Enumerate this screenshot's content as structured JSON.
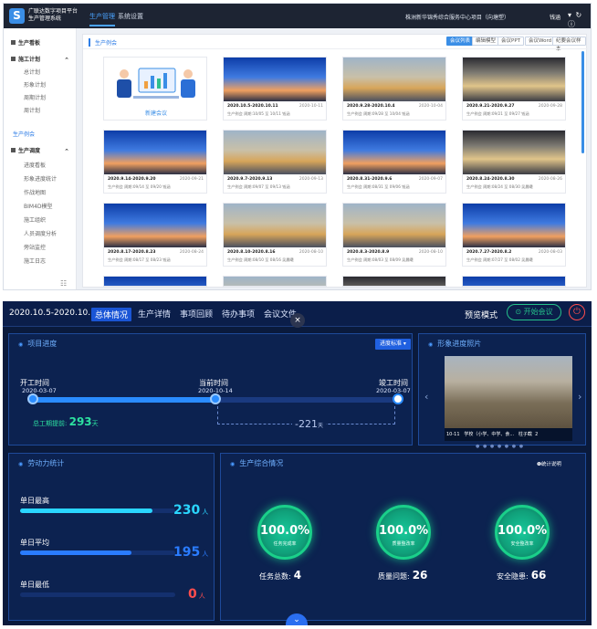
{
  "top": {
    "app_title": "广联达数字项目平台 生产管理系统",
    "logo_letter": "S",
    "nav": [
      "生产管理",
      "系统设置"
    ],
    "org": "株洲新华锦秀综合服务中心项目（向塘塑）",
    "user": "钱涵",
    "top_icons": "▾ ↻ ⓘ",
    "sidebar": {
      "items": [
        {
          "label": "生产看板",
          "type": "h"
        },
        {
          "label": "施工计划",
          "type": "h"
        },
        {
          "label": "总计划",
          "type": "sub"
        },
        {
          "label": "形象计划",
          "type": "sub"
        },
        {
          "label": "周期计划",
          "type": "sub"
        },
        {
          "label": "周计划",
          "type": "sub"
        },
        {
          "label": "生产例会",
          "type": "act"
        },
        {
          "label": "生产调度",
          "type": "h"
        },
        {
          "label": "进度看板",
          "type": "sub"
        },
        {
          "label": "形象进度统计",
          "type": "sub"
        },
        {
          "label": "作战地图",
          "type": "sub"
        },
        {
          "label": "BIM4D模型",
          "type": "sub"
        },
        {
          "label": "施工组织",
          "type": "sub"
        },
        {
          "label": "人员调度分析",
          "type": "sub"
        },
        {
          "label": "旁站监控",
          "type": "sub"
        },
        {
          "label": "施工日志",
          "type": "sub"
        }
      ],
      "footer_icon": "☷"
    },
    "content": {
      "title": "生产例会",
      "buttons": [
        "会议列表",
        "编辑模型",
        "会议PPT",
        "会议Word",
        "纪要会议样本"
      ],
      "new_label": "新建会议",
      "cards": [
        {
          "title": "2020.10.5-2020.10.11",
          "date": "2020-10-11",
          "meta": "生产例会  周期:10/05 至 10/11  钱涵",
          "img": "a"
        },
        {
          "title": "2020.9.28-2020.10.4",
          "date": "2020-10-04",
          "meta": "生产例会  周期:09/28 至 10/04  钱涵",
          "img": "b"
        },
        {
          "title": "2020.9.21-2020.9.27",
          "date": "2020-09-28",
          "meta": "生产例会  周期:09/21 至 09/27  钱涵",
          "img": "c"
        },
        {
          "title": "2020.9.14-2020.9.20",
          "date": "2020-09-21",
          "meta": "生产例会  周期:09/14 至 09/20  钱涵",
          "img": "a"
        },
        {
          "title": "2020.9.7-2020.9.13",
          "date": "2020-09-13",
          "meta": "生产例会  周期:09/07 至 09/13  钱涵",
          "img": "b"
        },
        {
          "title": "2020.8.31-2020.9.6",
          "date": "2020-09-07",
          "meta": "生产例会  周期:08/31 至 09/06  钱涵",
          "img": "a"
        },
        {
          "title": "2020.8.24-2020.8.30",
          "date": "2020-08-26",
          "meta": "生产例会  周期:08/24 至 08/30  吴晨曦",
          "img": "c"
        },
        {
          "title": "2020.8.17-2020.8.23",
          "date": "2020-08-24",
          "meta": "生产例会  周期:08/17 至 08/23  钱涵",
          "img": "a"
        },
        {
          "title": "2020.8.10-2020.8.16",
          "date": "2020-08-10",
          "meta": "生产例会  周期:08/10 至 08/16  吴晨曦",
          "img": "b"
        },
        {
          "title": "2020.8.3-2020.8.9",
          "date": "2020-08-10",
          "meta": "生产例会  周期:08/03 至 08/09  吴晨曦",
          "img": "b"
        },
        {
          "title": "2020.7.27-2020.8.2",
          "date": "2020-08-03",
          "meta": "生产例会  周期:07/27 至 08/02  吴晨曦",
          "img": "a"
        }
      ]
    }
  },
  "bottom": {
    "date_range": "2020.10.5-2020.10.11",
    "tabs": [
      "总体情况",
      "生产详情",
      "事项回顾",
      "待办事项",
      "会议文件"
    ],
    "close": "×",
    "preview_mode": "预览模式",
    "start_meeting": "⊙ 开始会议",
    "power": "⏻",
    "progress": {
      "title": "项目进度",
      "select": "进度标准 ▾",
      "start_label": "开工时间",
      "start_date": "2020-03-07",
      "current_label": "当前时间",
      "current_date": "2020-10-14",
      "end_label": "竣工时间",
      "end_date": "2020-03-07",
      "early_prefix": "总工期提前:",
      "early_days": "293",
      "early_unit": "天",
      "remaining": "-221",
      "remaining_unit": "天",
      "fraction": 0.5
    },
    "photo": {
      "title": "形象进度照片",
      "caption_date": "10-11",
      "caption_text": "学校（小学、中学、食...",
      "caption_right": "柱子截",
      "caption_num": "2",
      "prev": "‹",
      "next": "›",
      "dots": "● ● ● ● ● ● ●"
    },
    "labor": {
      "title": "劳动力统计",
      "items": [
        {
          "label": "单日最高",
          "value": "230",
          "unit": "人",
          "fraction": 0.85,
          "color": "#2ad6ff"
        },
        {
          "label": "单日平均",
          "value": "195",
          "unit": "人",
          "fraction": 0.72,
          "color": "#2a7cff"
        },
        {
          "label": "单日最低",
          "value": "0",
          "unit": "人",
          "fraction": 0,
          "color": "#ff4d4d"
        }
      ]
    },
    "production": {
      "title": "生产综合情况",
      "hint": "❶统计说明",
      "rings": [
        {
          "pct": "100.0%",
          "label": "任务完成率",
          "count_label": "任务总数:",
          "count": "4"
        },
        {
          "pct": "100.0%",
          "label": "质量整改率",
          "count_label": "质量问题:",
          "count": "26"
        },
        {
          "pct": "100.0%",
          "label": "安全整改率",
          "count_label": "安全隐患:",
          "count": "66"
        }
      ]
    },
    "down": "⌄"
  }
}
